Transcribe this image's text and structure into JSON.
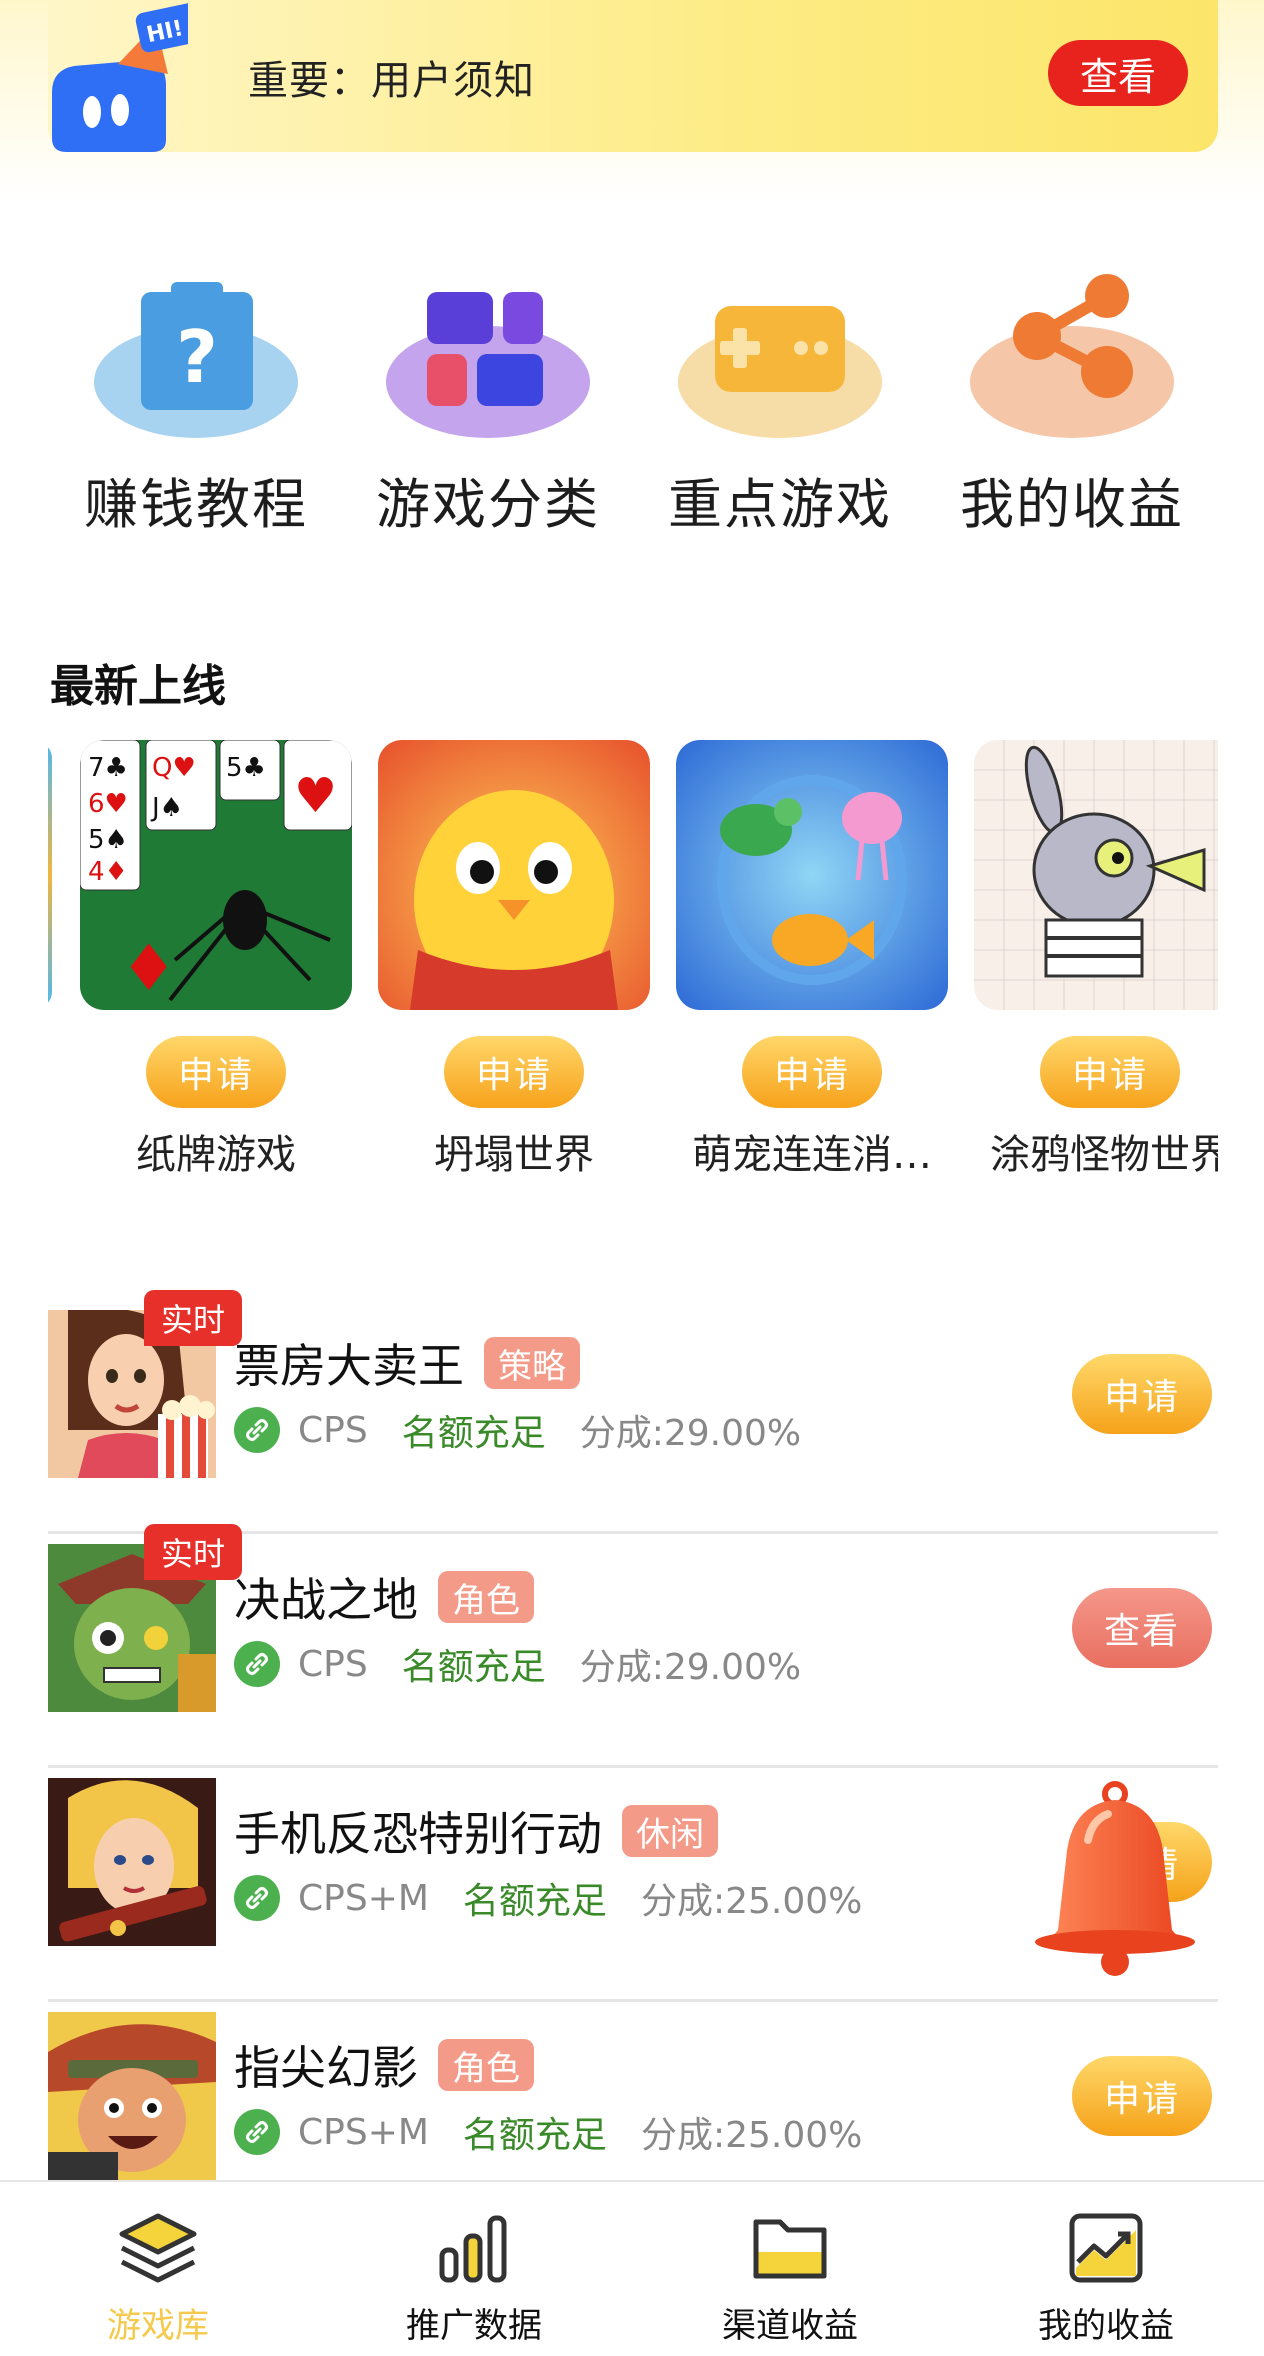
{
  "notice": {
    "text": "重要：用户须知",
    "button": "查看",
    "badge": "HI!"
  },
  "quick_menu": [
    {
      "label": "赚钱教程",
      "icon": "question-bag-icon"
    },
    {
      "label": "游戏分类",
      "icon": "category-grid-icon"
    },
    {
      "label": "重点游戏",
      "icon": "gamepad-icon"
    },
    {
      "label": "我的收益",
      "icon": "share-icon"
    }
  ],
  "newest": {
    "title": "最新上线",
    "games": [
      {
        "name": "纸牌游戏",
        "button": "申请"
      },
      {
        "name": "坍塌世界",
        "button": "申请"
      },
      {
        "name": "萌宠连连消…",
        "button": "申请"
      },
      {
        "name": "涂鸦怪物世界",
        "button": "申请"
      }
    ]
  },
  "list": [
    {
      "title": "票房大卖王",
      "tag": "策略",
      "realtime": "实时",
      "type": "CPS",
      "quota": "名额充足",
      "share": "分成:29.00%",
      "button": "申请"
    },
    {
      "title": "决战之地",
      "tag": "角色",
      "realtime": "实时",
      "type": "CPS",
      "quota": "名额充足",
      "share": "分成:29.00%",
      "button": "查看"
    },
    {
      "title": "手机反恐特别行动",
      "tag": "休闲",
      "realtime": "",
      "type": "CPS+M",
      "quota": "名额充足",
      "share": "分成:25.00%",
      "button": "申请"
    },
    {
      "title": "指尖幻影",
      "tag": "角色",
      "realtime": "",
      "type": "CPS+M",
      "quota": "名额充足",
      "share": "分成:25.00%",
      "button": "申请"
    }
  ],
  "bottom_nav": [
    {
      "label": "游戏库",
      "active": true
    },
    {
      "label": "推广数据",
      "active": false
    },
    {
      "label": "渠道收益",
      "active": false
    },
    {
      "label": "我的收益",
      "active": false
    }
  ],
  "colors": {
    "accent": "#f5c94b",
    "danger": "#e8231e",
    "apply": "#f5a21a",
    "view": "#e96f60",
    "quota_green": "#3a8a2a"
  }
}
